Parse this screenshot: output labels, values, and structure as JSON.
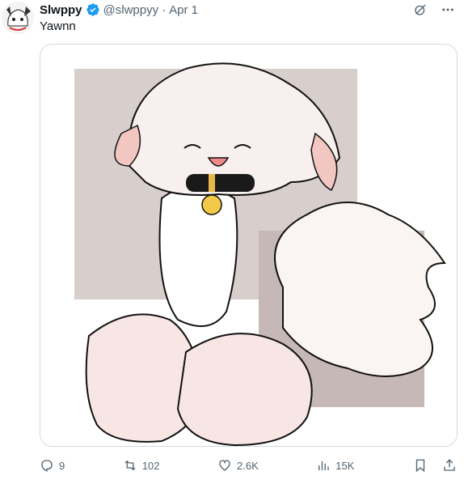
{
  "tweet": {
    "author_name": "Slwppy",
    "handle": "@slwppyy",
    "separator": "·",
    "date": "Apr 1",
    "text": "Yawnn",
    "media_alt": "image"
  },
  "actions": {
    "replies": "9",
    "retweets": "102",
    "likes": "2.6K",
    "views": "15K"
  },
  "icons": {
    "verified": "verified-badge-icon",
    "grok": "grok-icon",
    "more": "more-icon",
    "reply": "reply-icon",
    "retweet": "retweet-icon",
    "like": "like-icon",
    "views": "views-icon",
    "bookmark": "bookmark-icon",
    "share": "share-icon"
  },
  "colors": {
    "verified_blue": "#1d9bf0",
    "muted_text": "#536471",
    "border": "#cfd9de",
    "text": "#0f1419"
  }
}
